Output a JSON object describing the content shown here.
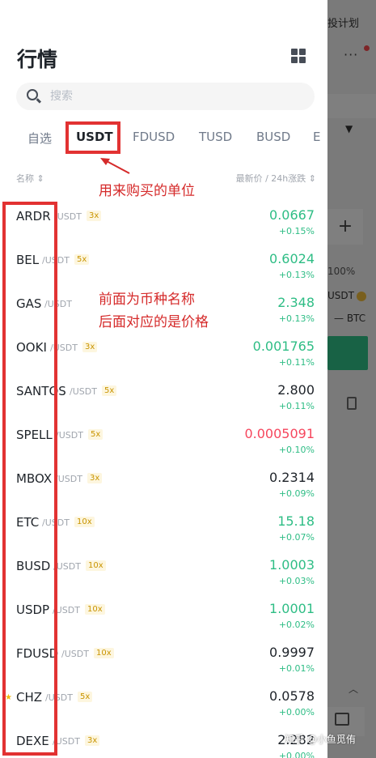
{
  "background": {
    "top_button": "投计划",
    "percent": "100%",
    "pair_base": "USDT",
    "pair_quote": "BTC"
  },
  "header": {
    "title": "行情",
    "layout_icon": "grid-layout-icon"
  },
  "search": {
    "placeholder": "搜索"
  },
  "tabs": [
    {
      "label": "自选",
      "active": false
    },
    {
      "label": "USDT",
      "active": true
    },
    {
      "label": "FDUSD",
      "active": false
    },
    {
      "label": "TUSD",
      "active": false
    },
    {
      "label": "BUSD",
      "active": false
    },
    {
      "label": "E",
      "active": false
    }
  ],
  "columns": {
    "name": "名称 ⇕",
    "price_change": "最新价 / 24h涨跌 ⇕"
  },
  "annotations": {
    "tab_note": "用来购买的单位",
    "list_note_line1": "前面为币种名称",
    "list_note_line2": "后面对应的是价格"
  },
  "colors": {
    "up": "#2ebd85",
    "down": "#f6465d",
    "highlight": "#e23232"
  },
  "rows": [
    {
      "symbol": "ARDR",
      "quote": "/USDT",
      "leverage": "3x",
      "price": "0.0667",
      "change": "+0.15%",
      "price_color": "up",
      "starred": false
    },
    {
      "symbol": "BEL",
      "quote": "/USDT",
      "leverage": "5x",
      "price": "0.6024",
      "change": "+0.13%",
      "price_color": "up",
      "starred": false
    },
    {
      "symbol": "GAS",
      "quote": "/USDT",
      "leverage": "",
      "price": "2.348",
      "change": "+0.13%",
      "price_color": "up",
      "starred": false
    },
    {
      "symbol": "OOKI",
      "quote": "/USDT",
      "leverage": "3x",
      "price": "0.001765",
      "change": "+0.11%",
      "price_color": "up",
      "starred": false
    },
    {
      "symbol": "SANTOS",
      "quote": "/USDT",
      "leverage": "5x",
      "price": "2.800",
      "change": "+0.11%",
      "price_color": "neutral",
      "starred": false
    },
    {
      "symbol": "SPELL",
      "quote": "/USDT",
      "leverage": "5x",
      "price": "0.0005091",
      "change": "+0.10%",
      "price_color": "down",
      "starred": false
    },
    {
      "symbol": "MBOX",
      "quote": "/USDT",
      "leverage": "3x",
      "price": "0.2314",
      "change": "+0.09%",
      "price_color": "neutral",
      "starred": false
    },
    {
      "symbol": "ETC",
      "quote": "/USDT",
      "leverage": "10x",
      "price": "15.18",
      "change": "+0.07%",
      "price_color": "up",
      "starred": false
    },
    {
      "symbol": "BUSD",
      "quote": "/USDT",
      "leverage": "10x",
      "price": "1.0003",
      "change": "+0.03%",
      "price_color": "up",
      "starred": false
    },
    {
      "symbol": "USDP",
      "quote": "/USDT",
      "leverage": "10x",
      "price": "1.0001",
      "change": "+0.02%",
      "price_color": "up",
      "starred": false
    },
    {
      "symbol": "FDUSD",
      "quote": "/USDT",
      "leverage": "10x",
      "price": "0.9997",
      "change": "+0.01%",
      "price_color": "neutral",
      "starred": false
    },
    {
      "symbol": "CHZ",
      "quote": "/USDT",
      "leverage": "5x",
      "price": "0.0578",
      "change": "+0.00%",
      "price_color": "neutral",
      "starred": true
    },
    {
      "symbol": "DEXE",
      "quote": "/USDT",
      "leverage": "3x",
      "price": "2.282",
      "change": "+0.00%",
      "price_color": "neutral",
      "starred": false
    }
  ],
  "watermark": "知乎 @小鱼觅侑"
}
